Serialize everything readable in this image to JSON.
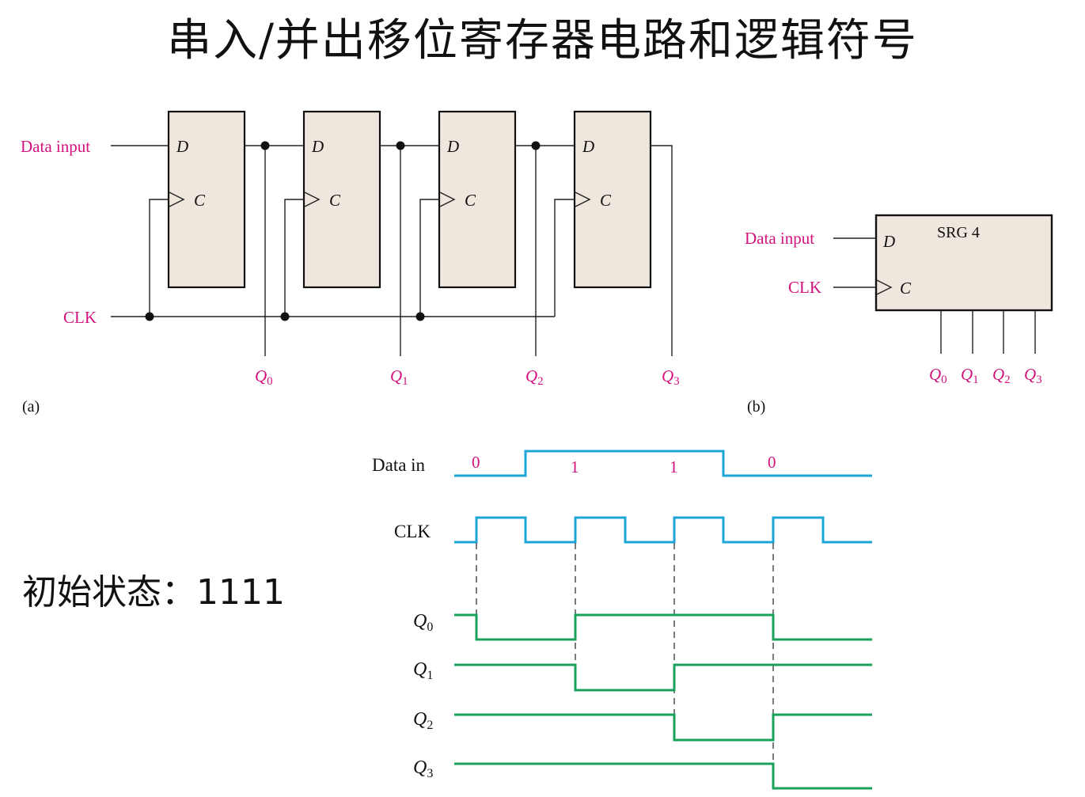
{
  "title": "串入/并出移位寄存器电路和逻辑符号",
  "initial_state": "初始状态：1111",
  "circuit_a": {
    "data_input_label": "Data input",
    "clk_label": "CLK",
    "d_label": "D",
    "c_label": "C",
    "outputs": [
      {
        "letter": "Q",
        "sub": "0"
      },
      {
        "letter": "Q",
        "sub": "1"
      },
      {
        "letter": "Q",
        "sub": "2"
      },
      {
        "letter": "Q",
        "sub": "3"
      }
    ],
    "caption": "(a)"
  },
  "symbol_b": {
    "data_input_label": "Data input",
    "clk_label": "CLK",
    "name": "SRG 4",
    "d_label": "D",
    "c_label": "C",
    "outputs": [
      {
        "letter": "Q",
        "sub": "0"
      },
      {
        "letter": "Q",
        "sub": "1"
      },
      {
        "letter": "Q",
        "sub": "2"
      },
      {
        "letter": "Q",
        "sub": "3"
      }
    ],
    "caption": "(b)"
  },
  "timing": {
    "data_in_label": "Data in",
    "clk_label": "CLK",
    "data_values": [
      "0",
      "1",
      "1",
      "0"
    ],
    "q_labels": [
      {
        "letter": "Q",
        "sub": "0"
      },
      {
        "letter": "Q",
        "sub": "1"
      },
      {
        "letter": "Q",
        "sub": "2"
      },
      {
        "letter": "Q",
        "sub": "3"
      }
    ]
  },
  "colors": {
    "label": "#d4127e",
    "clock_trace": "#1ea5d8",
    "q_trace": "#1aa05a",
    "flipflop_fill": "#efe7de"
  }
}
